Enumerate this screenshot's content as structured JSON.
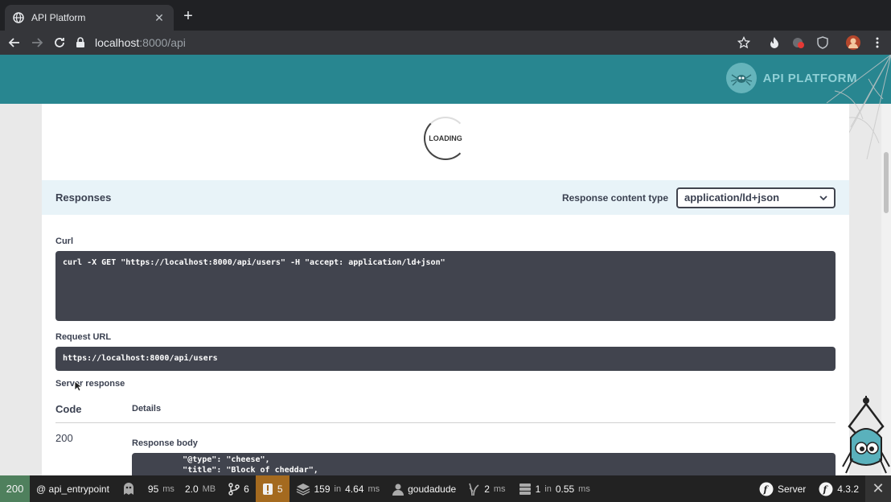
{
  "browser": {
    "tab_title": "API Platform",
    "url_host": "localhost",
    "url_path": ":8000/api"
  },
  "brand": {
    "name": "API PLATFORM"
  },
  "loading": {
    "text": "LOADING"
  },
  "responses": {
    "title": "Responses",
    "content_type_label": "Response content type",
    "content_type_value": "application/ld+json"
  },
  "curl": {
    "label": "Curl",
    "command": "curl -X GET \"https://localhost:8000/api/users\" -H \"accept: application/ld+json\""
  },
  "request_url": {
    "label": "Request URL",
    "value": "https://localhost:8000/api/users"
  },
  "server_response": {
    "label": "Server response",
    "code_header": "Code",
    "details_header": "Details",
    "code": "200",
    "body_label": "Response body",
    "body_lines": [
      "         \"@type\": \"cheese\",",
      "         \"title\": \"Block of cheddar\","
    ]
  },
  "debug_toolbar": {
    "status": "200",
    "route": "@ api_entrypoint",
    "time_value": "95",
    "time_unit": "ms",
    "memory_value": "2.0",
    "memory_unit": "MB",
    "events_count": "6",
    "logs_count": "5",
    "db_queries": "159",
    "db_in": "in",
    "db_time": "4.64",
    "db_unit": "ms",
    "user": "goudadude",
    "twig_time": "2",
    "twig_unit": "ms",
    "cache_count": "1",
    "cache_in": "in",
    "cache_time": "0.55",
    "cache_unit": "ms",
    "server_label": "Server",
    "symfony_version": "4.3.2"
  }
}
